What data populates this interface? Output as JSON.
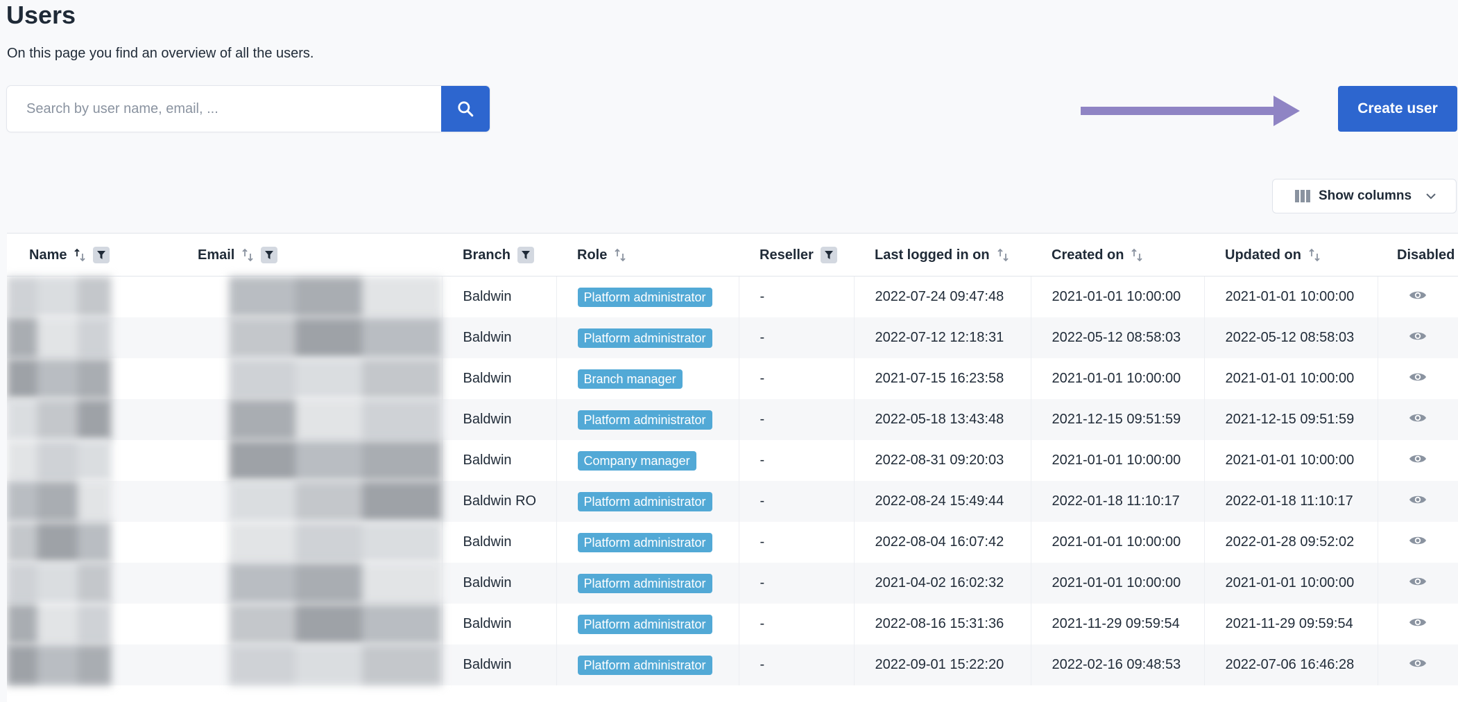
{
  "page": {
    "title": "Users",
    "subtitle": "On this page you find an overview of all the users."
  },
  "search": {
    "placeholder": "Search by user name, email, ...",
    "value": ""
  },
  "toolbar": {
    "create_user_label": "Create user",
    "show_columns_label": "Show columns"
  },
  "colors": {
    "primary": "#2d66cf",
    "badge": "#52a9d6",
    "arrow": "#8f84c4"
  },
  "table": {
    "columns": {
      "name": "Name",
      "email": "Email",
      "branch": "Branch",
      "role": "Role",
      "reseller": "Reseller",
      "last_logged_in": "Last logged in on",
      "created_on": "Created on",
      "updated_on": "Updated on",
      "disabled": "Disabled"
    },
    "rows": [
      {
        "branch": "Baldwin",
        "role": "Platform administrator",
        "reseller": "-",
        "last_logged_in": "2022-07-24 09:47:48",
        "created_on": "2021-01-01 10:00:00",
        "updated_on": "2021-01-01 10:00:00"
      },
      {
        "branch": "Baldwin",
        "role": "Platform administrator",
        "reseller": "-",
        "last_logged_in": "2022-07-12 12:18:31",
        "created_on": "2022-05-12 08:58:03",
        "updated_on": "2022-05-12 08:58:03"
      },
      {
        "branch": "Baldwin",
        "role": "Branch manager",
        "reseller": "-",
        "last_logged_in": "2021-07-15 16:23:58",
        "created_on": "2021-01-01 10:00:00",
        "updated_on": "2021-01-01 10:00:00"
      },
      {
        "branch": "Baldwin",
        "role": "Platform administrator",
        "reseller": "-",
        "last_logged_in": "2022-05-18 13:43:48",
        "created_on": "2021-12-15 09:51:59",
        "updated_on": "2021-12-15 09:51:59"
      },
      {
        "branch": "Baldwin",
        "role": "Company manager",
        "reseller": "-",
        "last_logged_in": "2022-08-31 09:20:03",
        "created_on": "2021-01-01 10:00:00",
        "updated_on": "2021-01-01 10:00:00"
      },
      {
        "branch": "Baldwin RO",
        "role": "Platform administrator",
        "reseller": "-",
        "last_logged_in": "2022-08-24 15:49:44",
        "created_on": "2022-01-18 11:10:17",
        "updated_on": "2022-01-18 11:10:17"
      },
      {
        "branch": "Baldwin",
        "role": "Platform administrator",
        "reseller": "-",
        "last_logged_in": "2022-08-04 16:07:42",
        "created_on": "2021-01-01 10:00:00",
        "updated_on": "2022-01-28 09:52:02"
      },
      {
        "branch": "Baldwin",
        "role": "Platform administrator",
        "reseller": "-",
        "last_logged_in": "2021-04-02 16:02:32",
        "created_on": "2021-01-01 10:00:00",
        "updated_on": "2021-01-01 10:00:00"
      },
      {
        "branch": "Baldwin",
        "role": "Platform administrator",
        "reseller": "-",
        "last_logged_in": "2022-08-16 15:31:36",
        "created_on": "2021-11-29 09:59:54",
        "updated_on": "2021-11-29 09:59:54"
      },
      {
        "branch": "Baldwin",
        "role": "Platform administrator",
        "reseller": "-",
        "last_logged_in": "2022-09-01 15:22:20",
        "created_on": "2022-02-16 09:48:53",
        "updated_on": "2022-07-06 16:46:28"
      }
    ]
  },
  "icons": {
    "search": "search-icon",
    "sort": "sort-icon",
    "filter": "filter-icon",
    "columns": "columns-icon",
    "chevron": "chevron-down-icon",
    "view": "eye-icon"
  }
}
